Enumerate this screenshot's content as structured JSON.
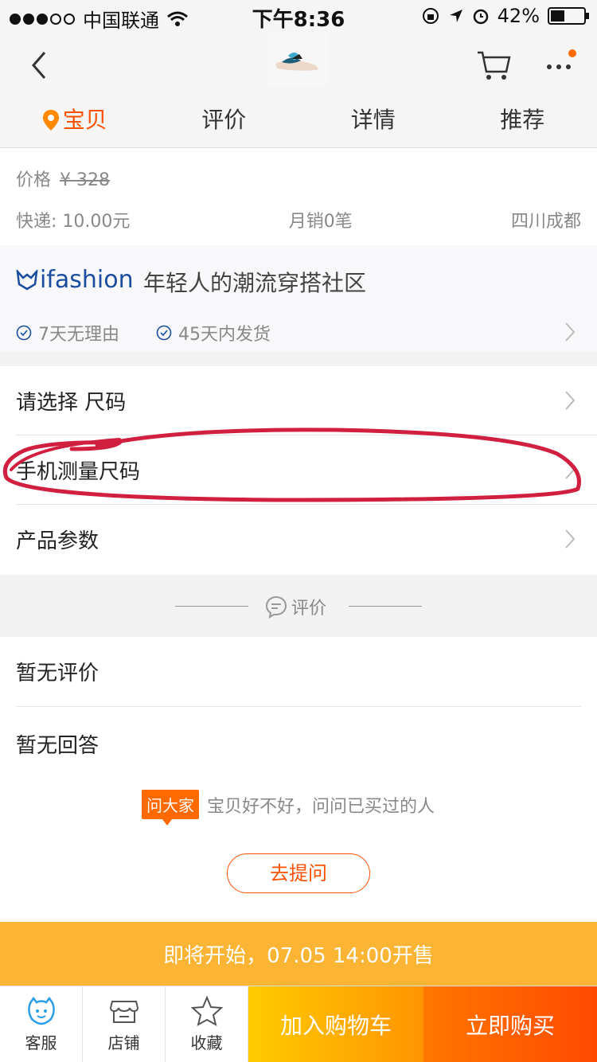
{
  "status_bar": {
    "carrier": "中国联通",
    "time": "下午8:36",
    "battery": "42%",
    "battery_level": 0.42
  },
  "header": {
    "tabs": [
      {
        "label": "宝贝",
        "active": true
      },
      {
        "label": "评价",
        "active": false
      },
      {
        "label": "详情",
        "active": false
      },
      {
        "label": "推荐",
        "active": false
      }
    ]
  },
  "product": {
    "price_label": "价格",
    "price_original": "¥ 328",
    "shipping": "快递: 10.00元",
    "monthly_sales": "月销0笔",
    "location": "四川成都"
  },
  "brand": {
    "logo_text": "ifashion",
    "slogan": "年轻人的潮流穿搭社区",
    "guarantees": [
      "7天无理由",
      "45天内发货"
    ]
  },
  "options": [
    "请选择 尺码",
    "手机测量尺码",
    "产品参数"
  ],
  "review_section": {
    "divider_label": "评价",
    "no_reviews": "暂无评价",
    "no_answers": "暂无回答",
    "ask_badge": "问大家",
    "ask_text": "宝贝好不好，问问已买过的人",
    "ask_button": "去提问"
  },
  "presale": {
    "text": "即将开始，07.05 14:00开售"
  },
  "bottom_bar": {
    "service": "客服",
    "shop": "店铺",
    "favorite": "收藏",
    "add_to_cart": "加入购物车",
    "buy_now": "立即购买"
  },
  "colors": {
    "accent": "#ff5000",
    "brand_blue": "#1a4da0",
    "presale_bg": "#fbb433",
    "annotation": "#d1203f"
  }
}
